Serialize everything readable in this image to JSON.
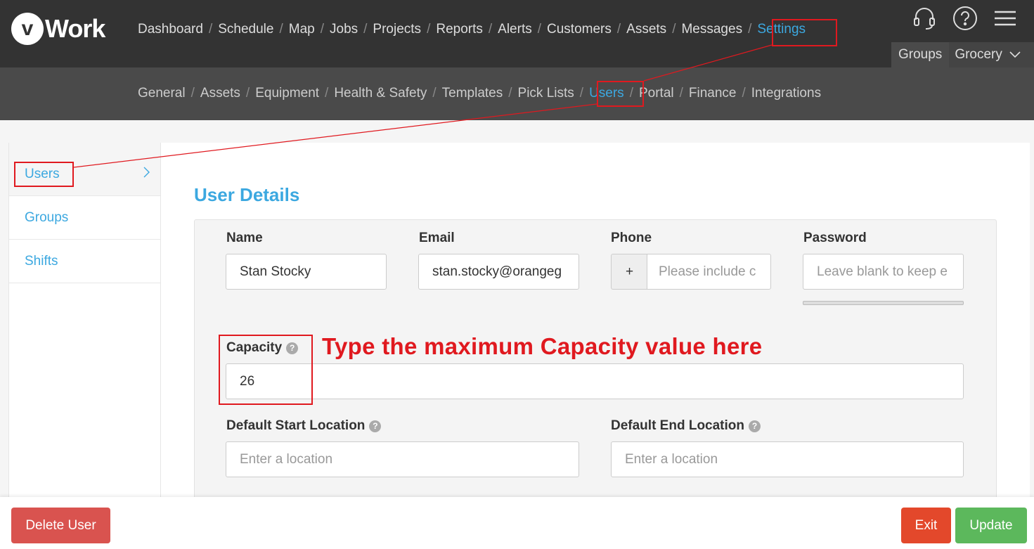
{
  "brand": {
    "logo_letter": "v",
    "logo_text": "Work"
  },
  "main_nav": {
    "items": [
      "Dashboard",
      "Schedule",
      "Map",
      "Jobs",
      "Projects",
      "Reports",
      "Alerts",
      "Customers",
      "Assets",
      "Messages",
      "Settings"
    ],
    "active": "Settings",
    "separator": "/"
  },
  "top_icons": [
    "headset-icon",
    "help-circle-icon",
    "hamburger-menu-icon"
  ],
  "group_selector": {
    "groups_label": "Groups",
    "selected_group": "Grocery"
  },
  "settings_nav": {
    "items": [
      "General",
      "Assets",
      "Equipment",
      "Health & Safety",
      "Templates",
      "Pick Lists",
      "Users",
      "Portal",
      "Finance",
      "Integrations"
    ],
    "active": "Users"
  },
  "sidebar": {
    "items": [
      {
        "label": "Users",
        "active": true
      },
      {
        "label": "Groups"
      },
      {
        "label": "Shifts"
      }
    ]
  },
  "form": {
    "title": "User Details",
    "name": {
      "label": "Name",
      "value": "Stan Stocky"
    },
    "email": {
      "label": "Email",
      "value": "stan.stocky@orangeg"
    },
    "phone": {
      "label": "Phone",
      "prefix": "+",
      "placeholder": "Please include c"
    },
    "password": {
      "label": "Password",
      "placeholder": "Leave blank to keep e"
    },
    "capacity": {
      "label": "Capacity",
      "value": "26"
    },
    "default_start_location": {
      "label": "Default Start Location",
      "placeholder": "Enter a location"
    },
    "default_end_location": {
      "label": "Default End Location",
      "placeholder": "Enter a location"
    },
    "help_glyph": "?"
  },
  "annotation": {
    "text": "Type the maximum Capacity value here",
    "color": "#e0191f"
  },
  "footer": {
    "delete_label": "Delete User",
    "exit_label": "Exit",
    "update_label": "Update"
  },
  "colors": {
    "accent": "#3ca8e0",
    "topbar": "#333333",
    "subbar": "#4a4a4a",
    "delete": "#d9534f",
    "exit": "#e3482b",
    "update": "#5cb85c",
    "highlight_box": "#e0191f"
  }
}
